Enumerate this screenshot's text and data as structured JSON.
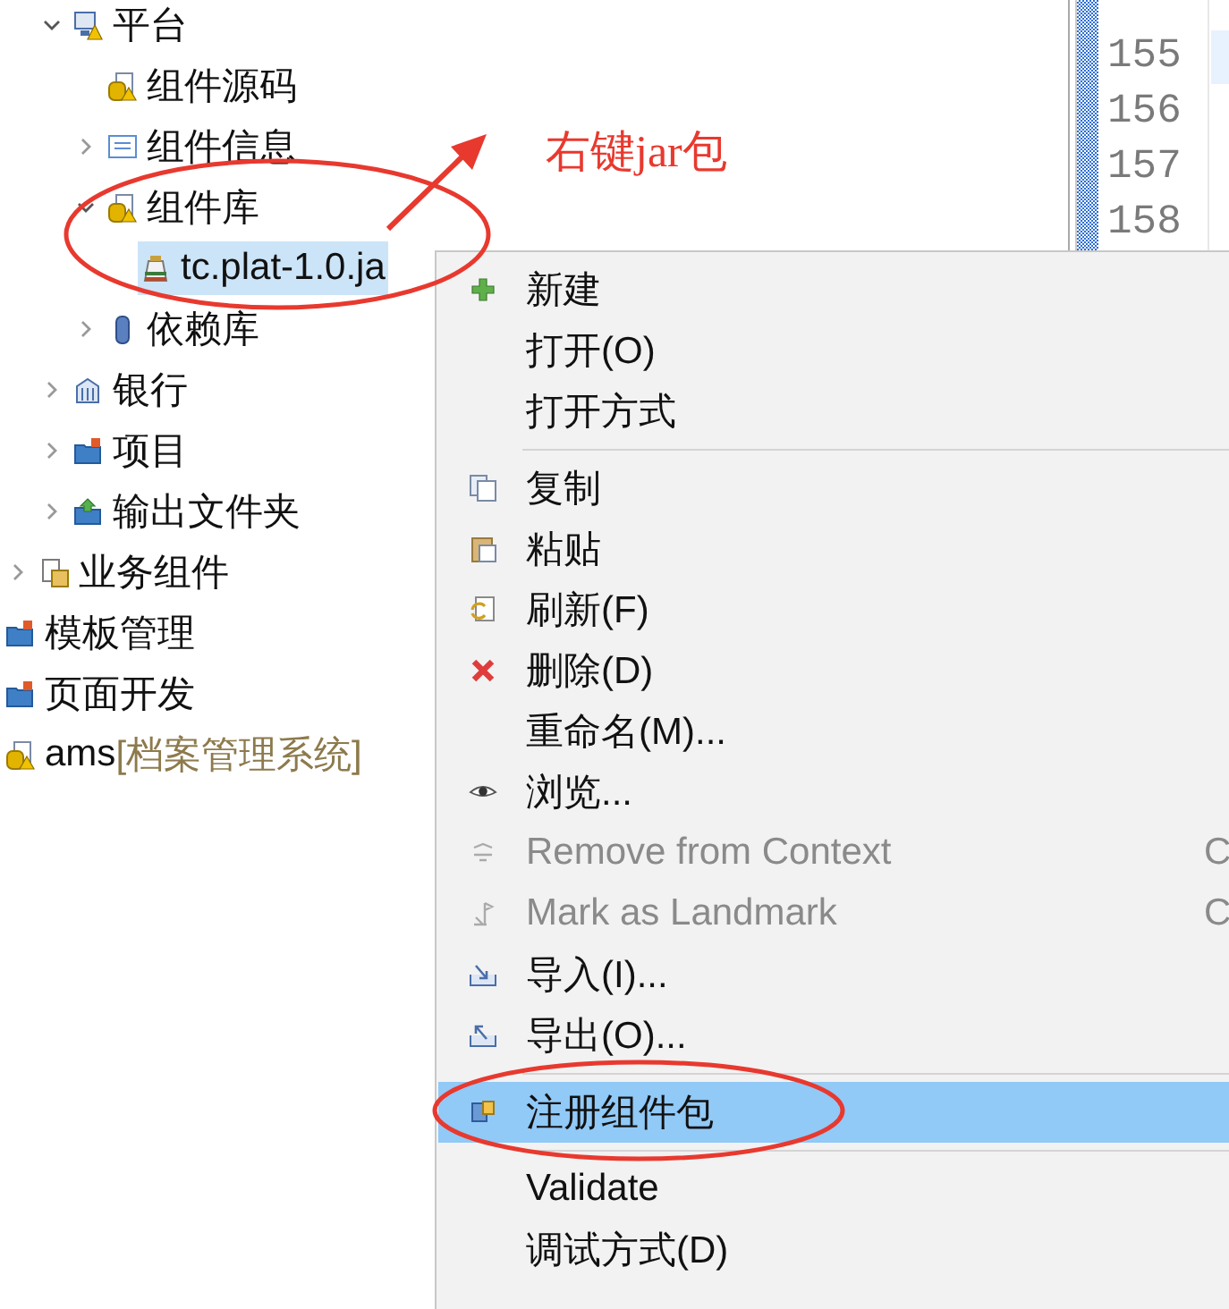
{
  "tree": [
    {
      "children": [
        {
          "children": [
            {
              "label": "平台",
              "expanded": true,
              "children": [
                {
                  "label": "组件源码"
                },
                {
                  "label": "组件信息",
                  "expanded": false
                },
                {
                  "label": "组件库",
                  "expanded": true,
                  "children": [
                    {
                      "label": "tc.plat-1.0.ja",
                      "selected": true
                    }
                  ]
                },
                {
                  "label": "依赖库",
                  "expanded": false
                }
              ]
            },
            {
              "label": "银行",
              "expanded": false
            },
            {
              "label": "项目",
              "expanded": false
            },
            {
              "label": "输出文件夹",
              "expanded": false
            }
          ]
        },
        {
          "label": "业务组件",
          "expanded": false
        }
      ]
    },
    {
      "label": "模板管理"
    },
    {
      "label": "页面开发"
    },
    {
      "label": "ams",
      "decoration": "[档案管理系统]"
    }
  ],
  "editor": {
    "line_numbers": [
      "155",
      "156",
      "157",
      "158"
    ]
  },
  "context_menu": [
    {
      "kind": "item",
      "label": "新建",
      "disabled": false,
      "selected": false
    },
    {
      "kind": "item",
      "label": "打开(O)",
      "disabled": false,
      "selected": false
    },
    {
      "kind": "item",
      "label": "打开方式",
      "disabled": false,
      "selected": false
    },
    {
      "kind": "separator"
    },
    {
      "kind": "item",
      "label": "复制",
      "disabled": false,
      "selected": false
    },
    {
      "kind": "item",
      "label": "粘贴",
      "disabled": false,
      "selected": false
    },
    {
      "kind": "item",
      "label": "刷新(F)",
      "disabled": false,
      "selected": false
    },
    {
      "kind": "item",
      "label": "删除(D)",
      "disabled": false,
      "selected": false
    },
    {
      "kind": "item",
      "label": "重命名(M)...",
      "disabled": false,
      "selected": false
    },
    {
      "kind": "item",
      "label": "浏览...",
      "disabled": false,
      "selected": false
    },
    {
      "kind": "item",
      "label": "Remove from Context",
      "shortcut": "C",
      "disabled": true,
      "selected": false
    },
    {
      "kind": "item",
      "label": "Mark as Landmark",
      "shortcut": "C",
      "disabled": true,
      "selected": false
    },
    {
      "kind": "item",
      "label": "导入(I)...",
      "disabled": false,
      "selected": false
    },
    {
      "kind": "item",
      "label": "导出(O)...",
      "disabled": false,
      "selected": false
    },
    {
      "kind": "separator"
    },
    {
      "kind": "item",
      "label": "注册组件包",
      "disabled": false,
      "selected": true
    },
    {
      "kind": "separator"
    },
    {
      "kind": "item",
      "label": "Validate",
      "disabled": false,
      "selected": false
    },
    {
      "kind": "item",
      "label": "调试方式(D)",
      "disabled": false,
      "selected": false
    }
  ],
  "annotation": {
    "note": "右键jar包"
  }
}
